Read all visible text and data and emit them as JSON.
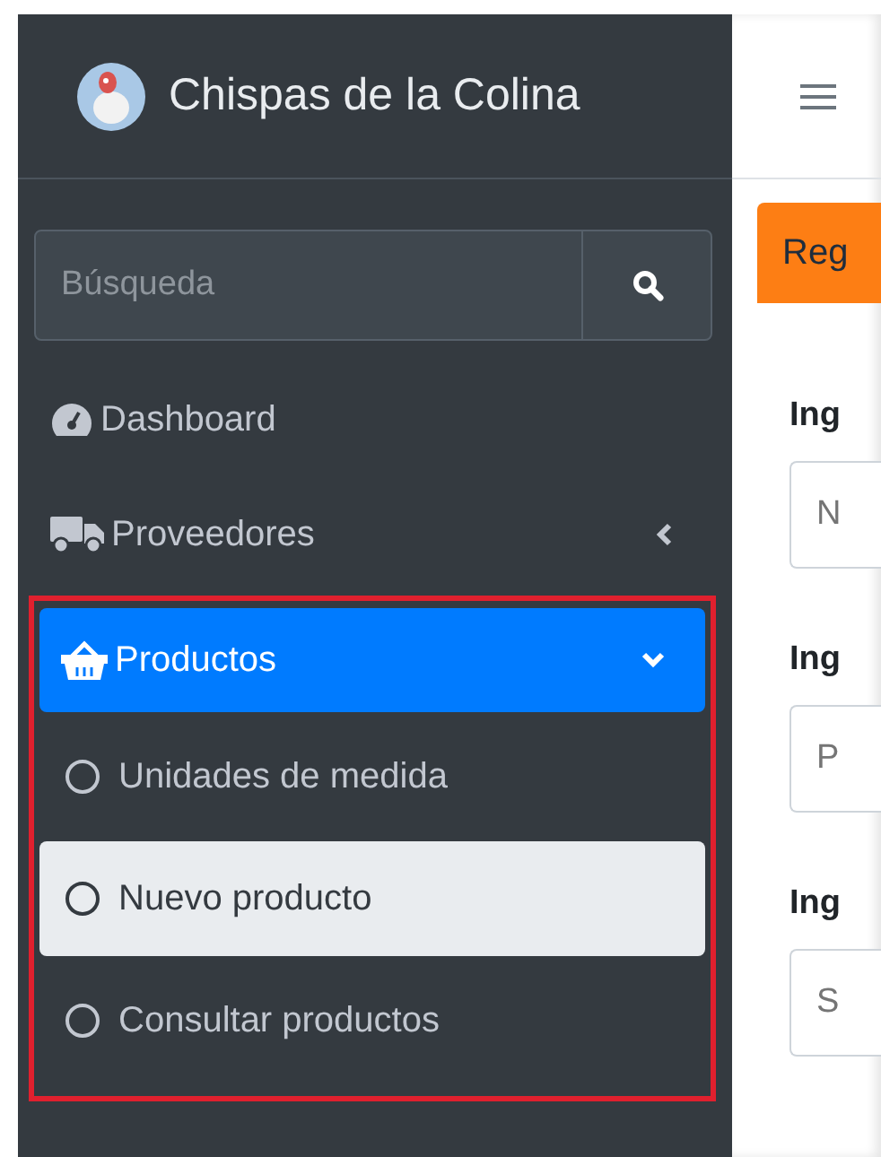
{
  "brand": {
    "name": "Chispas de la Colina"
  },
  "search": {
    "placeholder": "Búsqueda"
  },
  "nav": [
    {
      "label": "Dashboard",
      "selected": false
    },
    {
      "label": "Proveedores",
      "selected": false,
      "expanded": false
    },
    {
      "label": "Productos",
      "selected": true,
      "expanded": true,
      "highlighted": true,
      "children": [
        {
          "label": "Unidades de medida",
          "selected": false
        },
        {
          "label": "Nuevo producto",
          "selected": true
        },
        {
          "label": "Consultar productos",
          "selected": false
        }
      ]
    }
  ],
  "card": {
    "title": "Reg",
    "fields": [
      {
        "label": "Ing",
        "placeholder": "N"
      },
      {
        "label": "Ing",
        "placeholder": "P"
      },
      {
        "label": "Ing",
        "placeholder": "S"
      }
    ]
  }
}
